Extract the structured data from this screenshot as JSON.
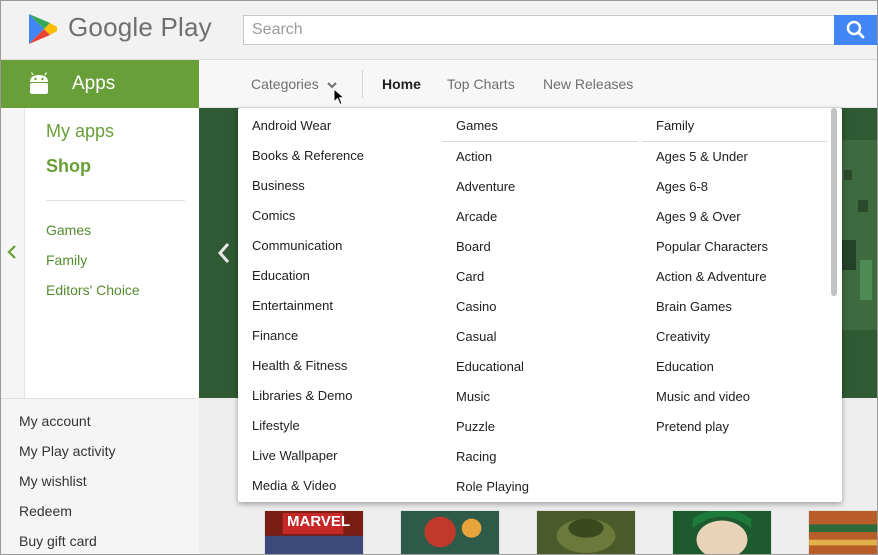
{
  "header": {
    "logo_text": "Google Play",
    "search_placeholder": "Search",
    "search_icon": "search-icon",
    "accent": "#4285f4"
  },
  "sidebar": {
    "section_label": "Apps",
    "section_icon": "android-icon",
    "section_color": "#689f38",
    "my_apps": "My apps",
    "shop": "Shop",
    "links": [
      "Games",
      "Family",
      "Editors' Choice"
    ],
    "account_links": [
      "My account",
      "My Play activity",
      "My wishlist",
      "Redeem",
      "Buy gift card"
    ]
  },
  "nav": {
    "categories": "Categories",
    "tabs": [
      "Home",
      "Top Charts",
      "New Releases"
    ],
    "active_tab": "Home"
  },
  "dropdown": {
    "columns": [
      {
        "items": [
          "Android Wear",
          "Books & Reference",
          "Business",
          "Comics",
          "Communication",
          "Education",
          "Entertainment",
          "Finance",
          "Health & Fitness",
          "Libraries & Demo",
          "Lifestyle",
          "Live Wallpaper",
          "Media & Video"
        ]
      },
      {
        "header": "Games",
        "items": [
          "Action",
          "Adventure",
          "Arcade",
          "Board",
          "Card",
          "Casino",
          "Casual",
          "Educational",
          "Music",
          "Puzzle",
          "Racing",
          "Role Playing"
        ]
      },
      {
        "header": "Family",
        "items": [
          "Ages 5 & Under",
          "Ages 6-8",
          "Ages 9 & Over",
          "Popular Characters",
          "Action & Adventure",
          "Brain Games",
          "Creativity",
          "Education",
          "Music and video",
          "Pretend play"
        ]
      }
    ]
  },
  "cards": {
    "first_card_label": "MARVEL"
  }
}
